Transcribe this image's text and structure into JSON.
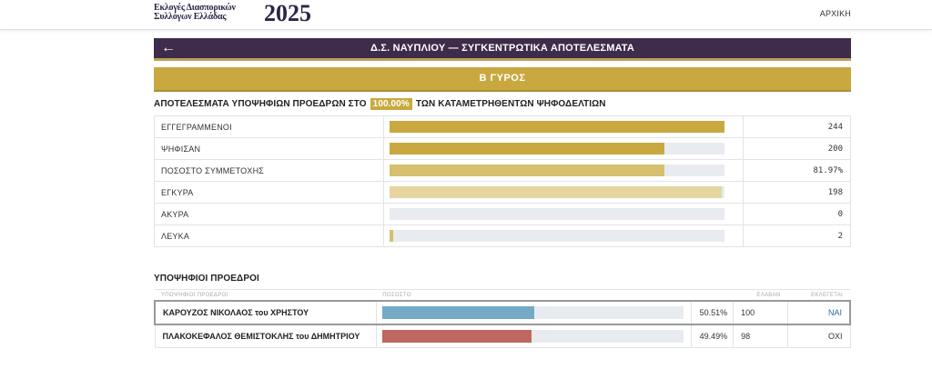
{
  "brand": {
    "line1": "Εκλογές Διασπορικών",
    "line2": "Συλλόγων Ελλάδας",
    "year": "2025"
  },
  "nav": {
    "home": "ΑΡΧΙΚΗ"
  },
  "header": {
    "title": "Δ.Σ. ΝΑΥΠΛΙΟΥ — ΣΥΓΚΕΝΤΡΩΤΙΚΑ ΑΠΟΤΕΛΕΣΜΑΤΑ"
  },
  "round": {
    "label": "Β ΓΥΡΟΣ"
  },
  "summary": {
    "title_prefix": "ΑΠΟΤΕΛΕΣΜΑΤΑ ΥΠΟΨΗΦΙΩΝ ΠΡΟΕΔΡΩΝ ΣΤΟ",
    "percent": "100.00%",
    "title_suffix": "ΤΩΝ ΚΑΤΑΜΕΤΡΗΘΕΝΤΩΝ ΨΗΦΟΔΕΛΤΙΩΝ"
  },
  "stats": [
    {
      "label": "ΕΓΓΕΓΡΑΜΜΕΝΟΙ",
      "value": "244",
      "fill": 1.0,
      "color": "#c9a93f"
    },
    {
      "label": "ΨΗΦΙΣΑΝ",
      "value": "200",
      "fill": 0.82,
      "color": "#c9a93f"
    },
    {
      "label": "ΠΟΣΟΣΤΟ ΣΥΜΜΕΤΟΧΗΣ",
      "value": "81.97%",
      "fill": 0.82,
      "color": "#d6bf6e"
    },
    {
      "label": "ΕΓΚΥΡΑ",
      "value": "198",
      "fill": 0.99,
      "color": "#e6d5a0"
    },
    {
      "label": "ΑΚΥΡΑ",
      "value": "0",
      "fill": 0.0,
      "color": "#e6d5a0"
    },
    {
      "label": "ΛΕΥΚΑ",
      "value": "2",
      "fill": 0.01,
      "color": "#d6bf6e"
    }
  ],
  "candidates": {
    "title": "ΥΠΟΨΗΦΙΟΙ ΠΡΟΕΔΡΟΙ",
    "headers": {
      "name": "ΥΠΟΨΗΦΙΟΙ ΠΡΟΕΔΡΟΙ",
      "percent": "ΠΟΣΟΣΤΟ",
      "votes": "ΕΛΑΒΑΝ",
      "elected": "ΕΚΛΕΓΕΤΑΙ"
    },
    "rows": [
      {
        "name": "ΚΑΡΟΥΖΟΣ ΝΙΚΟΛΑΟΣ του ΧΡΗΣΤΟΥ",
        "percent": "50.51%",
        "fill": 0.5051,
        "votes": "100",
        "elected": "ΝΑΙ",
        "color": "#74aac6"
      },
      {
        "name": "ΠΛΑΚΟΚΕΦΑΛΟΣ ΘΕΜΙΣΤΟΚΛΗΣ του ΔΗΜΗΤΡΙΟΥ",
        "percent": "49.49%",
        "fill": 0.4949,
        "votes": "98",
        "elected": "ΟΧΙ",
        "color": "#bf6862"
      }
    ]
  }
}
